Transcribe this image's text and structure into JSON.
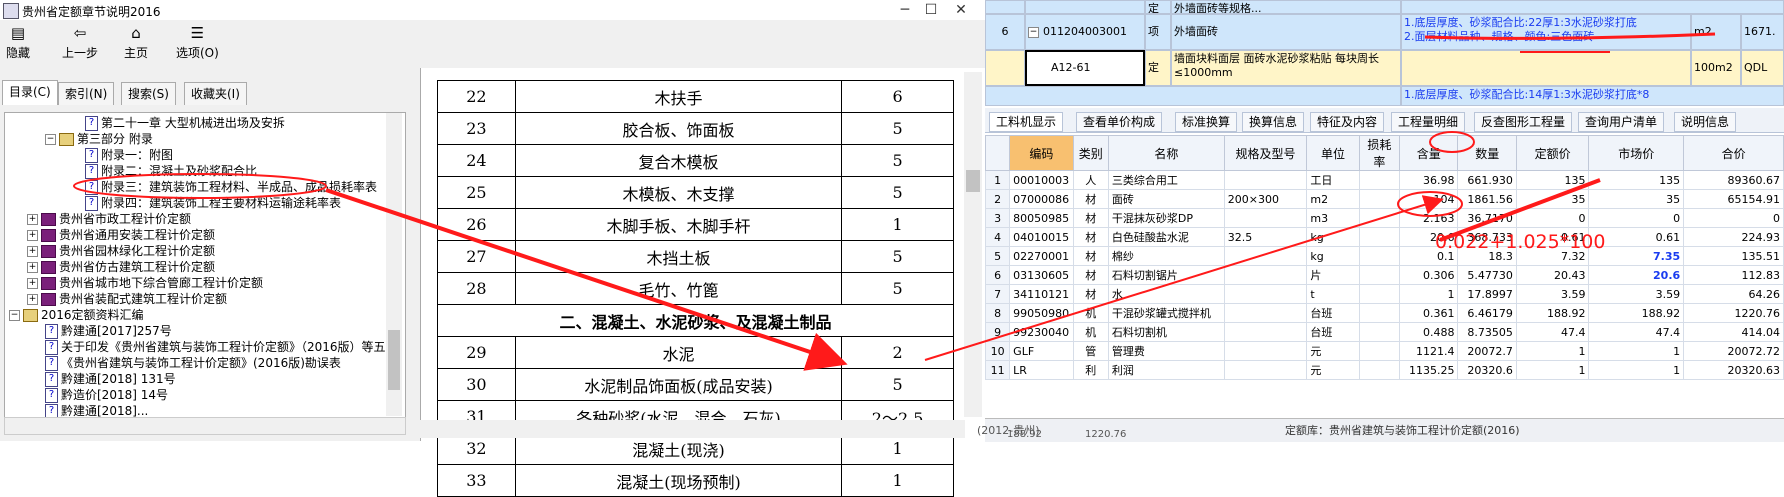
{
  "help_window": {
    "title": "贵州省定额章节说明2016",
    "controls": {
      "minimize": "─",
      "maximize": "☐",
      "close": "✕"
    },
    "toolbar": [
      {
        "label": "隐藏",
        "icon": "hide-icon"
      },
      {
        "label": "上一步",
        "icon": "back-arrow-icon"
      },
      {
        "label": "主页",
        "icon": "home-icon"
      },
      {
        "label": "选项(O)",
        "icon": "options-icon"
      }
    ],
    "nav_tabs": [
      "目录(C)",
      "索引(N)",
      "搜索(S)",
      "收藏夹(I)"
    ],
    "tree": [
      "第二十一章 大型机械进出场及安拆",
      "第三部分 附录",
      "附录一：附图",
      "附录二：混凝土及砂浆配合比",
      "附录三：建筑装饰工程材料、半成品、成品损耗率表",
      "附录四：建筑装饰工程主要材料运输途耗率表",
      "贵州省市政工程计价定额",
      "贵州省通用安装工程计价定额",
      "贵州省园林绿化工程计价定额",
      "贵州省仿古建筑工程计价定额",
      "贵州省城市地下综合管廊工程计价定额",
      "贵州省装配式建筑工程计价定额",
      "2016定额资料汇编",
      "黔建通[2017]257号",
      "关于印发《贵州省建筑与装饰工程计价定额》（2016版）等五",
      "《贵州省建筑与装饰工程计价定额》(2016版)勘误表",
      "黔建通[2018] 131号",
      "黔造价[2018] 14号",
      "黔建通[2018]..."
    ],
    "loss_table": [
      [
        "22",
        "木扶手",
        "6"
      ],
      [
        "23",
        "胶合板、饰面板",
        "5"
      ],
      [
        "24",
        "复合木模板",
        "5"
      ],
      [
        "25",
        "木模板、木支撑",
        "5"
      ],
      [
        "26",
        "木脚手板、木脚手杆",
        "1"
      ],
      [
        "27",
        "木挡土板",
        "5"
      ],
      [
        "28",
        "毛竹、竹篦",
        "5"
      ],
      [
        "",
        "二、混凝土、水泥砂浆、及混凝土制品",
        ""
      ],
      [
        "29",
        "水泥",
        "2"
      ],
      [
        "30",
        "水泥制品饰面板(成品安装)",
        "5"
      ],
      [
        "31",
        "各种砂浆(水泥、混合、石灰)",
        "2～2.5"
      ],
      [
        "32",
        "混凝土(现浇)",
        "1"
      ],
      [
        "33",
        "混凝土(现场预制)",
        "1"
      ]
    ]
  },
  "app": {
    "top_rows": [
      {
        "idx": "",
        "code": "",
        "type": "定",
        "name": "外墙面砖等规格...",
        "feature": "",
        "unit": "",
        "qty": ""
      },
      {
        "idx": "6",
        "code": "011204003001",
        "type": "项",
        "name": "外墙面砖",
        "feature": "1.底层厚度、砂浆配合比:22厚1:3水泥砂浆打底\n2.面层材料品种、规格、颜色:三色面砖",
        "unit": "m2",
        "qty": "1671."
      },
      {
        "idx": "",
        "code": "A12-61",
        "type": "定",
        "name": "墙面块料面层 面砖水泥砂浆粘贴 每块周长≤1000mm",
        "feature": "",
        "unit": "100m2",
        "qty": "QDL"
      },
      {
        "idx": "",
        "code": "",
        "type": "",
        "name": "",
        "feature": "1.底层厚度、砂浆配合比:14厚1:3水泥砂浆打底*8",
        "unit": "",
        "qty": ""
      }
    ],
    "tabs": [
      "工料机显示",
      "查看单价构成",
      "标准换算",
      "换算信息",
      "特征及内容",
      "工程量明细",
      "反查图形工程量",
      "查询用户清单",
      "说明信息"
    ],
    "grid_headers": [
      "编码",
      "类别",
      "名称",
      "规格及型号",
      "单位",
      "损耗率",
      "含量",
      "数量",
      "定额价",
      "市场价",
      "合价"
    ],
    "grid_rows": [
      [
        "1",
        "00010003",
        "人",
        "三类综合用工",
        "",
        "工日",
        "",
        "36.98",
        "661.930",
        "135",
        "135",
        "89360.67"
      ],
      [
        "2",
        "07000086",
        "材",
        "面砖",
        "200×300",
        "m2",
        "",
        "104",
        "1861.56",
        "35",
        "35",
        "65154.91"
      ],
      [
        "3",
        "80050985",
        "材",
        "干混抹灰砂浆DP",
        "",
        "m3",
        "",
        "2.163",
        "36.7170",
        "0",
        "0",
        "0"
      ],
      [
        "4",
        "04010015",
        "材",
        "白色硅酸盐水泥",
        "32.5",
        "kg",
        "",
        "20.6",
        "368.733",
        "0.61",
        "0.61",
        "224.93"
      ],
      [
        "5",
        "02270001",
        "材",
        "棉纱",
        "",
        "kg",
        "",
        "0.1",
        "18.3",
        "7.32",
        "7.35",
        "135.51"
      ],
      [
        "6",
        "03130605",
        "材",
        "石料切割锯片",
        "",
        "片",
        "",
        "0.306",
        "5.47730",
        "20.43",
        "20.6",
        "112.83"
      ],
      [
        "7",
        "34110121",
        "材",
        "水",
        "",
        "t",
        "",
        "1",
        "17.8997",
        "3.59",
        "3.59",
        "64.26"
      ],
      [
        "8",
        "99050980",
        "机",
        "干混砂浆罐式搅拌机",
        "",
        "台班",
        "",
        "0.361",
        "6.46179",
        "188.92",
        "188.92",
        "1220.76"
      ],
      [
        "9",
        "99230040",
        "机",
        "石料切割机",
        "",
        "台班",
        "",
        "0.488",
        "8.73505",
        "47.4",
        "47.4",
        "414.04"
      ],
      [
        "10",
        "GLF",
        "管",
        "管理费",
        "",
        "元",
        "",
        "1121.4",
        "20072.7",
        "1",
        "1",
        "20072.72"
      ],
      [
        "11",
        "LR",
        "利",
        "利润",
        "",
        "元",
        "",
        "1135.25",
        "20320.6",
        "1",
        "1",
        "20320.63"
      ]
    ],
    "status_left": "(2012-贵州)",
    "status_vals": [
      "188.92",
      "1220.76"
    ],
    "status_right": "定额库：贵州省建筑与装饰工程计价定额(2016)"
  },
  "annotation": "0.022+1.025*100",
  "colors": {
    "highlight_row": "#cfe6fb",
    "yellow_row": "#fff5c8",
    "header_orange": "#f8c070",
    "annotation_red": "#ff1a1a",
    "link_blue": "#1a3cf0"
  }
}
